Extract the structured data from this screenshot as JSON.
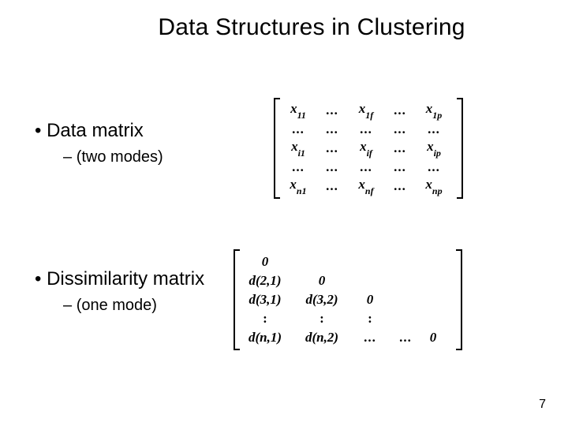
{
  "title": "Data Structures in Clustering",
  "bullets": {
    "data_matrix": {
      "label": "Data matrix",
      "sub": "(two modes)"
    },
    "dissimilarity_matrix": {
      "label": "Dissimilarity matrix",
      "sub": "(one mode)"
    }
  },
  "matrix1": {
    "rows": [
      [
        "x_11",
        "...",
        "x_1f",
        "...",
        "x_1p"
      ],
      [
        "...",
        "...",
        "...",
        "...",
        "..."
      ],
      [
        "x_i1",
        "...",
        "x_if",
        "...",
        "x_ip"
      ],
      [
        "...",
        "...",
        "...",
        "...",
        "..."
      ],
      [
        "x_n1",
        "...",
        "x_nf",
        "...",
        "x_np"
      ]
    ],
    "r0c0_base": "x",
    "r0c0_sub": "11",
    "r0c1": "...",
    "r0c2_base": "x",
    "r0c2_sub": "1f",
    "r0c3": "...",
    "r0c4_base": "x",
    "r0c4_sub": "1p",
    "r1c0": "...",
    "r1c1": "...",
    "r1c2": "...",
    "r1c3": "...",
    "r1c4": "...",
    "r2c0_base": "x",
    "r2c0_sub": "i1",
    "r2c1": "...",
    "r2c2_base": "x",
    "r2c2_sub": "if",
    "r2c3": "...",
    "r2c4_base": "x",
    "r2c4_sub": "ip",
    "r3c0": "...",
    "r3c1": "...",
    "r3c2": "...",
    "r3c3": "...",
    "r3c4": "...",
    "r4c0_base": "x",
    "r4c0_sub": "n1",
    "r4c1": "...",
    "r4c2_base": "x",
    "r4c2_sub": "nf",
    "r4c3": "...",
    "r4c4_base": "x",
    "r4c4_sub": "np"
  },
  "matrix2": {
    "rows": [
      [
        "0",
        "",
        "",
        "",
        ""
      ],
      [
        "d(2,1)",
        "0",
        "",
        "",
        ""
      ],
      [
        "d(3,1)",
        "d(3,2)",
        "0",
        "",
        ""
      ],
      [
        ":",
        ":",
        ":",
        "",
        ""
      ],
      [
        "d(n,1)",
        "d(n,2)",
        "...",
        "...",
        "0"
      ]
    ],
    "r0c0": "0",
    "r1c0": "d(2,1)",
    "r1c1": "0",
    "r2c0": "d(3,1)",
    "r2c1": "d(3,2)",
    "r2c2": "0",
    "r3c0": ":",
    "r3c1": ":",
    "r3c2": ":",
    "r4c0": "d(n,1)",
    "r4c1": "d(n,2)",
    "r4c2": "...",
    "r4c3": "...",
    "r4c4": "0"
  },
  "page_number": "7"
}
